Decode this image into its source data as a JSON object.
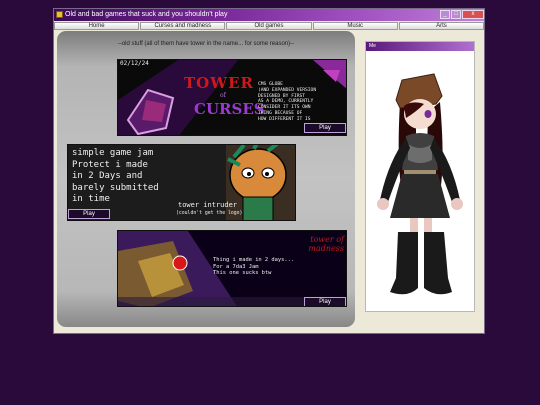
{
  "window": {
    "title": "Old and bad games that suck and you shouldn't play",
    "controls": {
      "minimize": "_",
      "maximize": "□",
      "close": "x"
    }
  },
  "nav": [
    {
      "label": "Home"
    },
    {
      "label": "Curses and madness"
    },
    {
      "label": "Old games"
    },
    {
      "label": "Music"
    },
    {
      "label": "Arts"
    }
  ],
  "main": {
    "caption": "--old stuff (all of them have tower in the name... for some reason)--",
    "games": [
      {
        "date": "02/12/24",
        "logo_line1": "TOWER",
        "logo_line2": "of",
        "logo_line3": "CURSES",
        "description": "CMS GLOBE\n(AND EXPANDED VERSION\nDESIGNED BY FIRST\nAS A DEMO, CURRENTLY\nCONSIDER IT ITS OWN\nTHING BECAUSE OF\nHOW DIFFERENT IT IS",
        "play_label": "Play"
      },
      {
        "description": "simple game jam\nProtect i made\nin 2 Days and\nbarely submitted\nin time",
        "title_text": "tower intruder",
        "subtitle_text": "(couldn't get the logo)",
        "play_label": "Play"
      },
      {
        "logo_text": "tower of madness",
        "description": "Thing i made in 2 days...\nFor a 7da3 Jam\nThis one sucks btw",
        "play_label": "Play"
      }
    ]
  },
  "side": {
    "header": "Me"
  },
  "colors": {
    "background": "#2a0a3a",
    "accent": "#8a3aaa",
    "window": "#ece9d8",
    "logo_red": "#d01818"
  }
}
